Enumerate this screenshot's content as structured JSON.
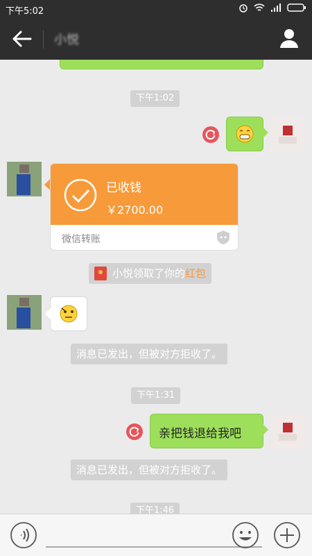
{
  "status_bar": {
    "time": "下午5:02"
  },
  "header": {
    "contact_name": "小悦"
  },
  "messages": {
    "timestamp_1": "下午1:02",
    "timestamp_2": "下午1:31",
    "timestamp_3": "下午1:46",
    "transfer": {
      "status": "已收钱",
      "amount": "￥2700.00",
      "footer": "微信转账"
    },
    "red_packet_notice_prefix": "小悦领取了你的",
    "red_packet_notice_link": "红包",
    "rejected_notice_1": "消息已发出，但被对方拒收了。",
    "rejected_notice_2": "消息已发出，但被对方拒收了。",
    "sent_text": "亲把钱退给我吧"
  },
  "colors": {
    "accent_green": "#9ddf5a",
    "transfer_orange": "#f79a3a",
    "header_bg": "#2e2e2e",
    "error_red": "#e5565c",
    "link_orange": "#f79a3a"
  }
}
